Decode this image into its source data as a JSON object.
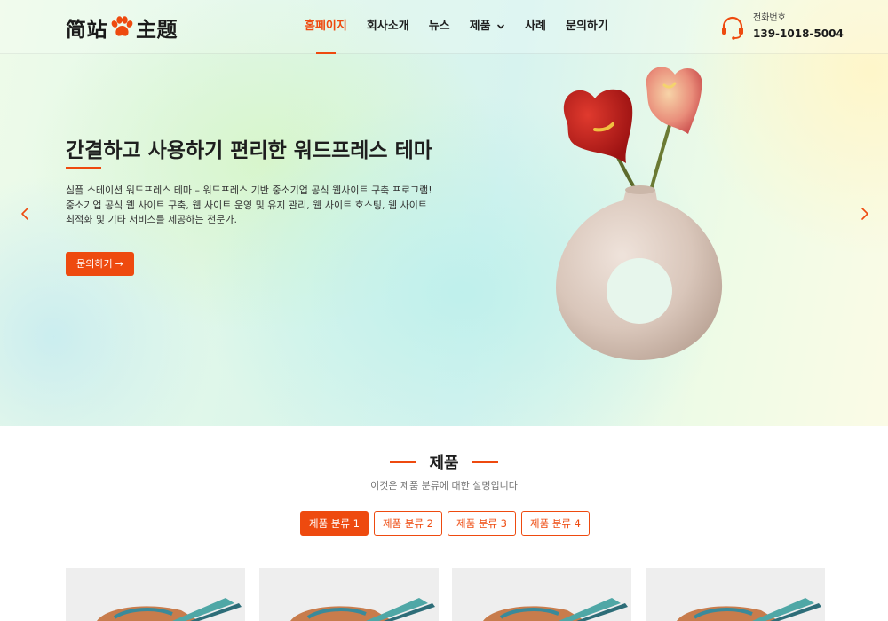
{
  "brand": {
    "logo_left": "简站",
    "logo_right": "主题",
    "accent": "#ee4a0f"
  },
  "nav": {
    "items": [
      {
        "label": "홈페이지",
        "active": true
      },
      {
        "label": "회사소개",
        "active": false
      },
      {
        "label": "뉴스",
        "active": false
      },
      {
        "label": "제품",
        "active": false,
        "has_dropdown": true
      },
      {
        "label": "사례",
        "active": false
      },
      {
        "label": "문의하기",
        "active": false
      }
    ]
  },
  "contact": {
    "label": "전화번호",
    "number": "139-1018-5004",
    "icon": "headset-icon"
  },
  "hero": {
    "title": "간결하고 사용하기 편리한 워드프레스 테마",
    "description": "심플 스테이션 워드프레스 테마 – 워드프레스 기반 중소기업 공식 웹사이트 구축 프로그램! 중소기업 공식 웹 사이트 구축, 웹 사이트 운영 및 유지 관리, 웹 사이트 호스팅, 웹 사이트 최적화 및 기타 서비스를 제공하는 전문가.",
    "button_label": "문의하기",
    "button_icon": "arrow-right-icon",
    "prev_icon": "chevron-left-icon",
    "next_icon": "chevron-right-icon"
  },
  "products": {
    "title": "제품",
    "subtitle": "이것은 제품 분류에 대한 설명입니다",
    "tabs": [
      {
        "label": "제품 분류 1",
        "active": true
      },
      {
        "label": "제품 분류 2",
        "active": false
      },
      {
        "label": "제품 분류 3",
        "active": false
      },
      {
        "label": "제품 분류 4",
        "active": false
      }
    ]
  }
}
